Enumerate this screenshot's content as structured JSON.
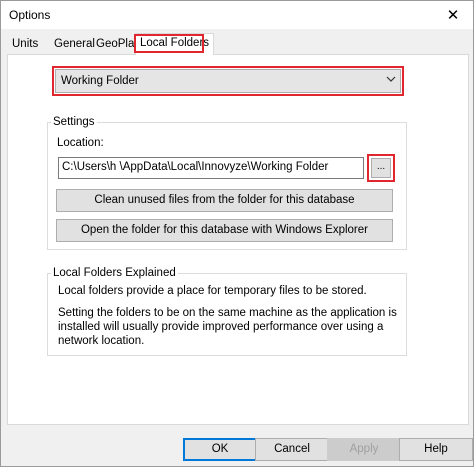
{
  "window": {
    "title": "Options",
    "close_glyph": "✕"
  },
  "tabs": [
    {
      "label": "Units"
    },
    {
      "label": "General"
    },
    {
      "label": "GeoPlan"
    },
    {
      "label": "Local Folders"
    }
  ],
  "folder_select": {
    "selected": "Working Folder",
    "arrow_icon": "chevron-down-icon"
  },
  "settings": {
    "group_label": "Settings",
    "location_label": "Location:",
    "location_value": "C:\\Users\\h           \\AppData\\Local\\Innovyze\\Working Folder",
    "browse_label": "...",
    "clean_label": "Clean unused files from the folder for this database",
    "open_label": "Open the folder for this database with Windows Explorer"
  },
  "explained": {
    "group_label": "Local Folders Explained",
    "text1": "Local folders provide a place for temporary files to be stored.",
    "text2": "Setting the folders to be on the same machine as the application is installed will usually provide improved performance over using a network location."
  },
  "footer": {
    "ok": "OK",
    "cancel": "Cancel",
    "apply": "Apply",
    "help": "Help"
  },
  "colors": {
    "highlight": "#e0262e",
    "default_button_border": "#0078d7"
  }
}
